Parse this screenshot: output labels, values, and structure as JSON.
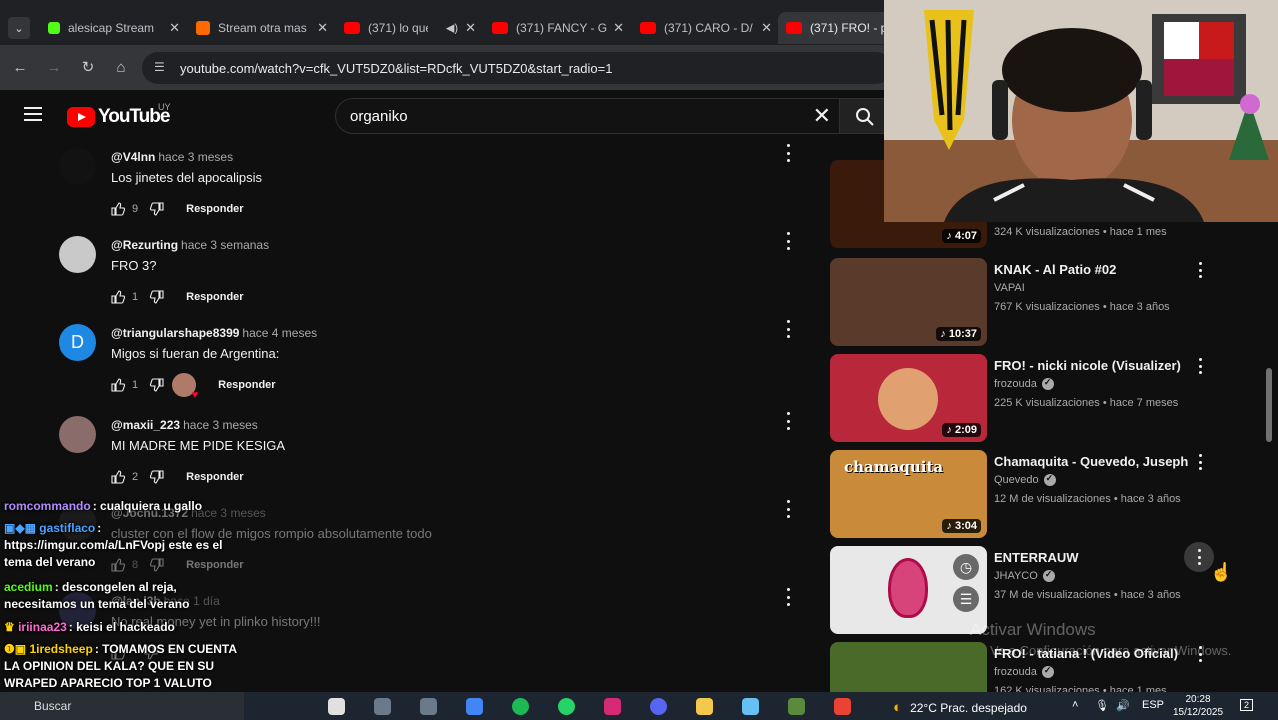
{
  "browser": {
    "tabs": [
      {
        "title": "alesicap Stream",
        "favicon_color": "#53fc18",
        "active": false
      },
      {
        "title": "Stream otra mas",
        "favicon_color": "#ff6a00",
        "active": false
      },
      {
        "title": "(371) lo que",
        "favicon_color": "#ff0000",
        "active": false,
        "audio": true
      },
      {
        "title": "(371) FANCY - G",
        "favicon_color": "#ff0000",
        "active": false
      },
      {
        "title": "(371) CARO - D/",
        "favicon_color": "#ff0000",
        "active": false
      },
      {
        "title": "(371) FRO! - pli",
        "favicon_color": "#ff0000",
        "active": true
      }
    ],
    "url": "youtube.com/watch?v=cfk_VUT5DZ0&list=RDcfk_VUT5DZ0&start_radio=1"
  },
  "youtube": {
    "logo_text": "YouTube",
    "country": "UY",
    "search_value": "organiko"
  },
  "comments": [
    {
      "author": "@V4lnn",
      "when": "hace 3 meses",
      "text": "Los jinetes del apocalipsis",
      "likes": "9",
      "reply": "Responder",
      "avatar_color": "#121212"
    },
    {
      "author": "@Rezurting",
      "when": "hace 3 semanas",
      "text": "FRO 3?",
      "likes": "1",
      "reply": "Responder",
      "avatar_color": "#c9c9c9"
    },
    {
      "author": "@triangularshape8399",
      "when": "hace 4 meses",
      "text": "Migos si fueran de Argentina:",
      "likes": "1",
      "reply": "Responder",
      "avatar_color": "#1e88e5",
      "avatar_letter": "D",
      "creator_heart": true
    },
    {
      "author": "@maxii_223",
      "when": "hace 3 meses",
      "text": "MI MADRE ME PIDE KESIGA",
      "likes": "2",
      "reply": "Responder",
      "avatar_color": "#8a6d6a"
    },
    {
      "author": "@Jochu.1372",
      "when": "hace 3 meses",
      "text": "cluster con el flow de migos rompio absolutamente todo",
      "likes": "8",
      "reply": "Responder",
      "avatar_color": "#2a2a2a"
    },
    {
      "author": "@lan.l3b",
      "when": "hace 1 día",
      "text": "No real money yet in plinko history!!!",
      "likes": "",
      "reply": "",
      "avatar_color": "#3a3a6a"
    }
  ],
  "recommendations": [
    {
      "title": "",
      "channel": "",
      "verified": false,
      "meta": "324 K visualizaciones • hace 1 mes",
      "duration": "4:07",
      "thumb_color": "#3a1a0a"
    },
    {
      "title": "KNAK - Al Patio #02",
      "channel": "VAPAI",
      "verified": false,
      "meta": "767 K visualizaciones • hace 3 años",
      "duration": "10:37",
      "thumb_color": "#5a3a2a"
    },
    {
      "title": "FRO! - nicki nicole (Visualizer)",
      "channel": "frozouda",
      "verified": true,
      "meta": "225 K visualizaciones • hace 7 meses",
      "duration": "2:09",
      "thumb_color": "#b8283a"
    },
    {
      "title": "Chamaquita - Quevedo, Juseph",
      "channel": "Quevedo",
      "verified": true,
      "meta": "12 M de visualizaciones • hace 3 años",
      "duration": "3:04",
      "thumb_color": "#c98a3a",
      "thumb_text": "chamaquita"
    },
    {
      "title": "ENTERRAUW",
      "channel": "JHAYCO",
      "verified": true,
      "meta": "37 M de visualizaciones • hace 3 años",
      "duration": "",
      "thumb_color": "#e8e8e8"
    },
    {
      "title": "FRO! - tatiana ! (Video Oficial)",
      "channel": "frozouda",
      "verified": true,
      "meta": "162 K visualizaciones • hace 1 mes",
      "duration": "",
      "thumb_color": "#4a6a2a"
    }
  ],
  "chat": [
    {
      "user": "romcommando",
      "user_color": "#b18cff",
      "text": ": cualquiera u gallo"
    },
    {
      "user": "gastiflaco",
      "user_color": "#4aa3ff",
      "text": ": https://imgur.com/a/LnFVopj este es el tema del verano"
    },
    {
      "user": "acedium",
      "user_color": "#53fc18",
      "text": ": descongelen al reja, necesitamos un tema del verano"
    },
    {
      "user": "iriinaa23",
      "user_color": "#ff6ad5",
      "text": ": keisi el hackeado"
    },
    {
      "user": "1iredsheep",
      "user_color": "#ffd400",
      "text": ": TOMAMOS EN CUENTA LA OPINION DEL KALA? QUE EN SU WRAPED APARECIO TOP 1 VALUTO"
    },
    {
      "user": "1iredsheep",
      "user_color": "#ffd400",
      "text": ": ?????"
    }
  ],
  "watermark": {
    "line1": "Activar Windows",
    "line2": "Ve a Configuración para activar Windows."
  },
  "taskbar": {
    "search_placeholder": "Buscar",
    "weather": "22°C  Prac. despejado",
    "lang": "ESP",
    "time": "20:28",
    "date": "15/12/2025",
    "notifications": "2",
    "icons": [
      "task-view",
      "app",
      "app",
      "chrome",
      "spotify",
      "whatsapp",
      "instagram",
      "discord",
      "explorer",
      "steam",
      "minecraft",
      "chrome-active"
    ]
  }
}
